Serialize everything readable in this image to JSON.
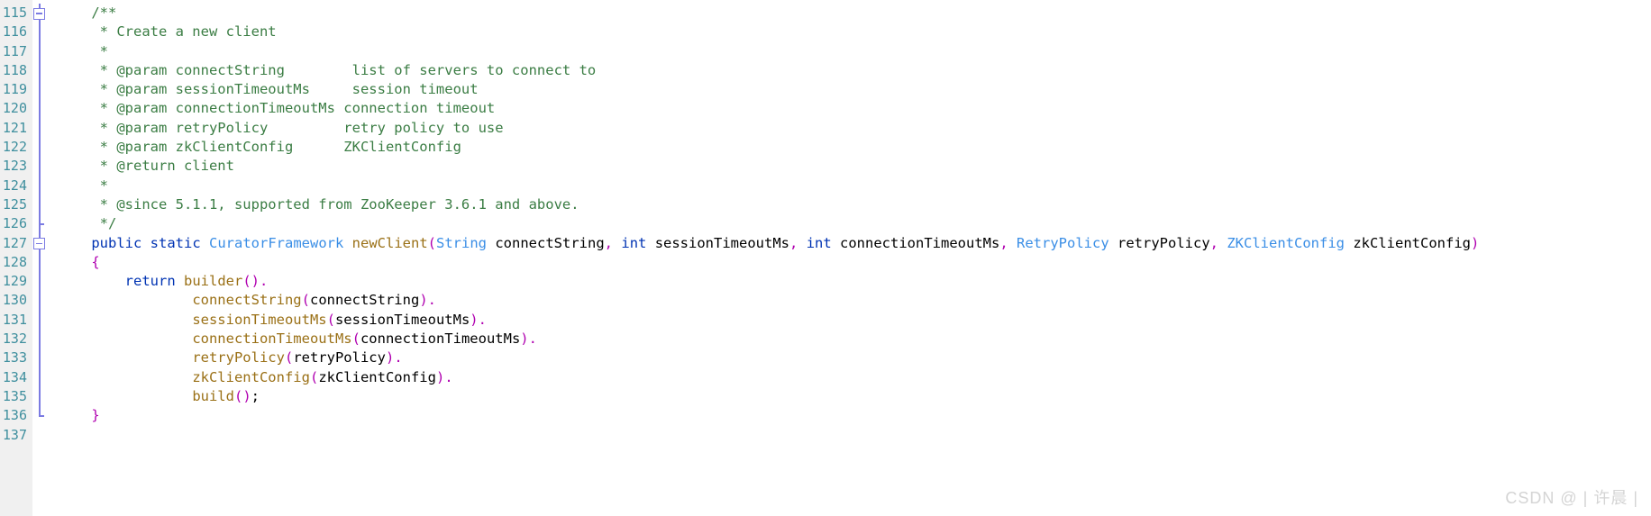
{
  "editor": {
    "language": "java",
    "first_line": 115,
    "last_line": 137,
    "background": "#ffffff",
    "gutter_background": "#f0f0f0",
    "line_number_color": "#3f8f9e",
    "fold_color": "#7b7be2"
  },
  "colors": {
    "comment": "#3b7d44",
    "keyword": "#0033b3",
    "type": "#3a8ee6",
    "method": "#9a7016",
    "punctuation": "#b000b0",
    "identifier": "#000000"
  },
  "gutter": {
    "line_numbers": [
      "115",
      "116",
      "117",
      "118",
      "119",
      "120",
      "121",
      "122",
      "123",
      "124",
      "125",
      "126",
      "127",
      "128",
      "129",
      "130",
      "131",
      "132",
      "133",
      "134",
      "135",
      "136",
      "137"
    ],
    "fold_markers": [
      {
        "line": "115",
        "type": "collapse-box"
      },
      {
        "line": "126",
        "type": "region-end"
      },
      {
        "line": "127",
        "type": "collapse-box"
      },
      {
        "line": "136",
        "type": "region-end"
      }
    ]
  },
  "lines": [
    {
      "num": "115",
      "tokens": [
        {
          "t": "    ",
          "c": "id"
        },
        {
          "t": "/**",
          "c": "cmt"
        }
      ]
    },
    {
      "num": "116",
      "tokens": [
        {
          "t": "     * Create a new client",
          "c": "cmt"
        }
      ]
    },
    {
      "num": "117",
      "tokens": [
        {
          "t": "     *",
          "c": "cmt"
        }
      ]
    },
    {
      "num": "118",
      "tokens": [
        {
          "t": "     * @param connectString        list of servers to connect to",
          "c": "cmt"
        }
      ]
    },
    {
      "num": "119",
      "tokens": [
        {
          "t": "     * @param sessionTimeoutMs     session timeout",
          "c": "cmt"
        }
      ]
    },
    {
      "num": "120",
      "tokens": [
        {
          "t": "     * @param connectionTimeoutMs connection timeout",
          "c": "cmt"
        }
      ]
    },
    {
      "num": "121",
      "tokens": [
        {
          "t": "     * @param retryPolicy         retry policy to use",
          "c": "cmt"
        }
      ]
    },
    {
      "num": "122",
      "tokens": [
        {
          "t": "     * @param zkClientConfig      ZKClientConfig",
          "c": "cmt"
        }
      ]
    },
    {
      "num": "123",
      "tokens": [
        {
          "t": "     * @return client",
          "c": "cmt"
        }
      ]
    },
    {
      "num": "124",
      "tokens": [
        {
          "t": "     *",
          "c": "cmt"
        }
      ]
    },
    {
      "num": "125",
      "tokens": [
        {
          "t": "     * @since 5.1.1, supported from ZooKeeper 3.6.1 and above.",
          "c": "cmt"
        }
      ]
    },
    {
      "num": "126",
      "tokens": [
        {
          "t": "     */",
          "c": "cmt"
        }
      ]
    },
    {
      "num": "127",
      "tokens": [
        {
          "t": "    ",
          "c": "id"
        },
        {
          "t": "public",
          "c": "kw"
        },
        {
          "t": " ",
          "c": "id"
        },
        {
          "t": "static",
          "c": "kw"
        },
        {
          "t": " ",
          "c": "id"
        },
        {
          "t": "CuratorFramework",
          "c": "type"
        },
        {
          "t": " ",
          "c": "id"
        },
        {
          "t": "newClient",
          "c": "mth"
        },
        {
          "t": "(",
          "c": "pun"
        },
        {
          "t": "String",
          "c": "type"
        },
        {
          "t": " connectString",
          "c": "id"
        },
        {
          "t": ",",
          "c": "pun"
        },
        {
          "t": " ",
          "c": "id"
        },
        {
          "t": "int",
          "c": "kw"
        },
        {
          "t": " sessionTimeoutMs",
          "c": "id"
        },
        {
          "t": ",",
          "c": "pun"
        },
        {
          "t": " ",
          "c": "id"
        },
        {
          "t": "int",
          "c": "kw"
        },
        {
          "t": " connectionTimeoutMs",
          "c": "id"
        },
        {
          "t": ",",
          "c": "pun"
        },
        {
          "t": " ",
          "c": "id"
        },
        {
          "t": "RetryPolicy",
          "c": "type"
        },
        {
          "t": " retryPolicy",
          "c": "id"
        },
        {
          "t": ",",
          "c": "pun"
        },
        {
          "t": " ",
          "c": "id"
        },
        {
          "t": "ZKClientConfig",
          "c": "type"
        },
        {
          "t": " zkClientConfig",
          "c": "id"
        },
        {
          "t": ")",
          "c": "pun"
        }
      ]
    },
    {
      "num": "128",
      "tokens": [
        {
          "t": "    ",
          "c": "id"
        },
        {
          "t": "{",
          "c": "pun"
        }
      ]
    },
    {
      "num": "129",
      "tokens": [
        {
          "t": "        ",
          "c": "id"
        },
        {
          "t": "return",
          "c": "kw"
        },
        {
          "t": " ",
          "c": "id"
        },
        {
          "t": "builder",
          "c": "mth"
        },
        {
          "t": "()",
          "c": "pun"
        },
        {
          "t": ".",
          "c": "pun"
        }
      ]
    },
    {
      "num": "130",
      "tokens": [
        {
          "t": "                ",
          "c": "id"
        },
        {
          "t": "connectString",
          "c": "mth"
        },
        {
          "t": "(",
          "c": "pun"
        },
        {
          "t": "connectString",
          "c": "id"
        },
        {
          "t": ")",
          "c": "pun"
        },
        {
          "t": ".",
          "c": "pun"
        }
      ]
    },
    {
      "num": "131",
      "tokens": [
        {
          "t": "                ",
          "c": "id"
        },
        {
          "t": "sessionTimeoutMs",
          "c": "mth"
        },
        {
          "t": "(",
          "c": "pun"
        },
        {
          "t": "sessionTimeoutMs",
          "c": "id"
        },
        {
          "t": ")",
          "c": "pun"
        },
        {
          "t": ".",
          "c": "pun"
        }
      ]
    },
    {
      "num": "132",
      "tokens": [
        {
          "t": "                ",
          "c": "id"
        },
        {
          "t": "connectionTimeoutMs",
          "c": "mth"
        },
        {
          "t": "(",
          "c": "pun"
        },
        {
          "t": "connectionTimeoutMs",
          "c": "id"
        },
        {
          "t": ")",
          "c": "pun"
        },
        {
          "t": ".",
          "c": "pun"
        }
      ]
    },
    {
      "num": "133",
      "tokens": [
        {
          "t": "                ",
          "c": "id"
        },
        {
          "t": "retryPolicy",
          "c": "mth"
        },
        {
          "t": "(",
          "c": "pun"
        },
        {
          "t": "retryPolicy",
          "c": "id"
        },
        {
          "t": ")",
          "c": "pun"
        },
        {
          "t": ".",
          "c": "pun"
        }
      ]
    },
    {
      "num": "134",
      "tokens": [
        {
          "t": "                ",
          "c": "id"
        },
        {
          "t": "zkClientConfig",
          "c": "mth"
        },
        {
          "t": "(",
          "c": "pun"
        },
        {
          "t": "zkClientConfig",
          "c": "id"
        },
        {
          "t": ")",
          "c": "pun"
        },
        {
          "t": ".",
          "c": "pun"
        }
      ]
    },
    {
      "num": "135",
      "tokens": [
        {
          "t": "                ",
          "c": "id"
        },
        {
          "t": "build",
          "c": "mth"
        },
        {
          "t": "()",
          "c": "pun"
        },
        {
          "t": ";",
          "c": "id"
        }
      ]
    },
    {
      "num": "136",
      "tokens": [
        {
          "t": "    ",
          "c": "id"
        },
        {
          "t": "}",
          "c": "pun"
        }
      ]
    },
    {
      "num": "137",
      "tokens": [
        {
          "t": "",
          "c": "id"
        }
      ]
    }
  ],
  "watermark": {
    "text": "CSDN @ | 许晨 |"
  }
}
